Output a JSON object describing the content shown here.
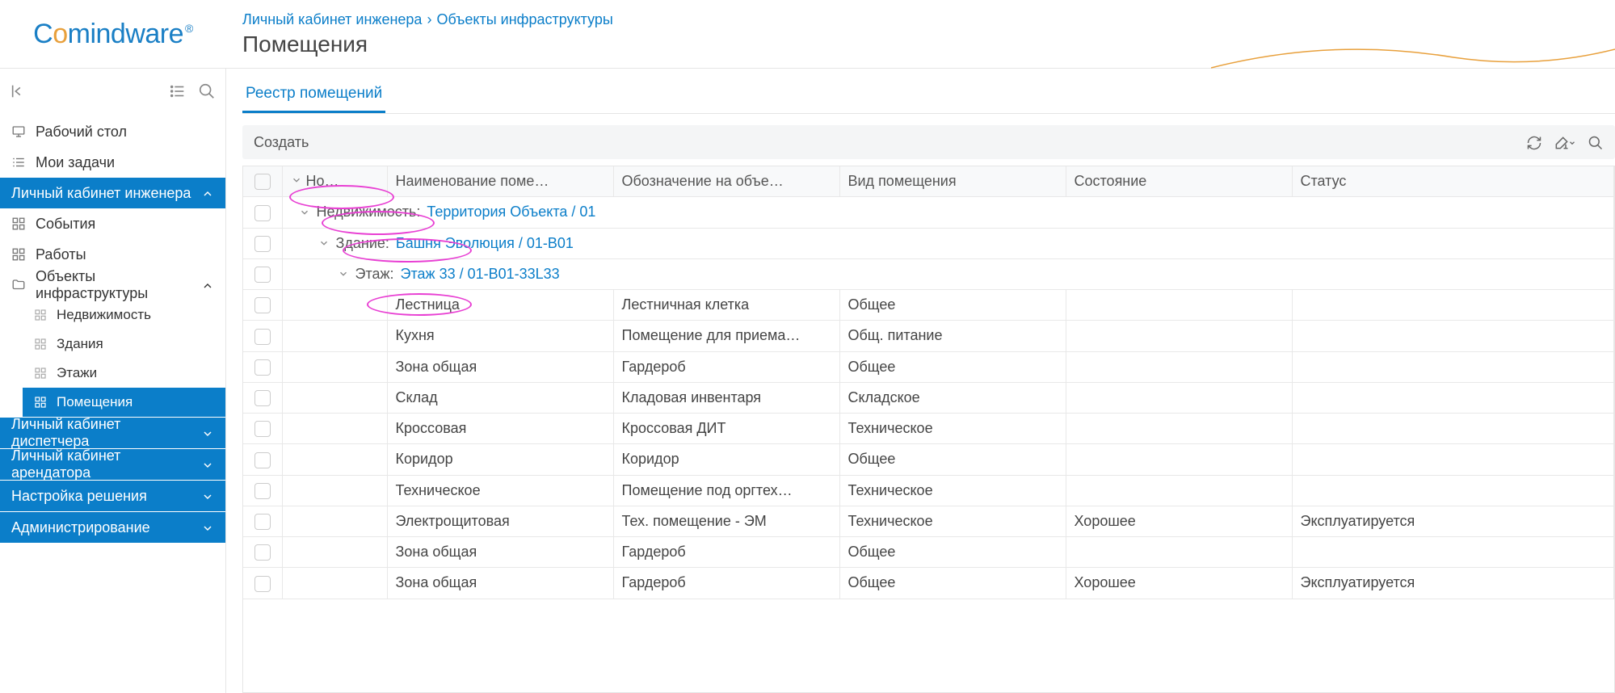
{
  "logo": {
    "part1": "C",
    "part2": "o",
    "part3": "mindware",
    "trademark": "®"
  },
  "breadcrumb": {
    "items": [
      "Личный кабинет инженера",
      "Объекты инфраструктуры"
    ],
    "title": "Помещения"
  },
  "sidebar": {
    "items": [
      {
        "label": "Рабочий стол"
      },
      {
        "label": "Мои задачи"
      },
      {
        "label": "Личный кабинет инженера",
        "selected": true,
        "expand": "up"
      },
      {
        "label": "События",
        "sub": true
      },
      {
        "label": "Работы",
        "sub": true
      },
      {
        "label": "Объекты инфраструктуры",
        "sub": true,
        "expand": "up"
      },
      {
        "label": "Недвижимость",
        "subsub": true
      },
      {
        "label": "Здания",
        "subsub": true
      },
      {
        "label": "Этажи",
        "subsub": true
      },
      {
        "label": "Помещения",
        "subsub": true,
        "active": true
      }
    ],
    "stack": [
      {
        "label": "Личный кабинет диспетчера"
      },
      {
        "label": "Личный кабинет арендатора"
      },
      {
        "label": "Настройка решения"
      },
      {
        "label": "Администрирование"
      }
    ]
  },
  "tab": "Реестр помещений",
  "toolbar": {
    "create": "Создать"
  },
  "columns": {
    "num": "Но…",
    "name": "Наименование поме…",
    "desig": "Обозначение на объе…",
    "kind": "Вид помещения",
    "cond": "Состояние",
    "status": "Статус"
  },
  "groups": {
    "g1": {
      "label": "Недвижимость:",
      "link": "Территория Объекта / 01"
    },
    "g2": {
      "label": "Здание:",
      "link": "Башня Эволюция / 01-B01"
    },
    "g3": {
      "label": "Этаж:",
      "link": "Этаж 33 / 01-B01-33L33"
    }
  },
  "rows": [
    {
      "name": "Лестница",
      "desig": "Лестничная клетка",
      "kind": "Общее",
      "cond": "",
      "status": ""
    },
    {
      "name": "Кухня",
      "desig": "Помещение для приема…",
      "kind": "Общ. питание",
      "cond": "",
      "status": ""
    },
    {
      "name": "Зона общая",
      "desig": "Гардероб",
      "kind": "Общее",
      "cond": "",
      "status": ""
    },
    {
      "name": "Склад",
      "desig": "Кладовая инвентаря",
      "kind": "Складское",
      "cond": "",
      "status": ""
    },
    {
      "name": "Кроссовая",
      "desig": "Кроссовая ДИТ",
      "kind": "Техническое",
      "cond": "",
      "status": ""
    },
    {
      "name": "Коридор",
      "desig": "Коридор",
      "kind": "Общее",
      "cond": "",
      "status": ""
    },
    {
      "name": "Техническое",
      "desig": "Помещение под оргтех…",
      "kind": "Техническое",
      "cond": "",
      "status": ""
    },
    {
      "name": "Электрощитовая",
      "desig": "Тех. помещение - ЭМ",
      "kind": "Техническое",
      "cond": "Хорошее",
      "status": "Эксплуатируется"
    },
    {
      "name": "Зона общая",
      "desig": "Гардероб",
      "kind": "Общее",
      "cond": "",
      "status": ""
    },
    {
      "name": "Зона общая",
      "desig": "Гардероб",
      "kind": "Общее",
      "cond": "Хорошее",
      "status": "Эксплуатируется"
    }
  ]
}
